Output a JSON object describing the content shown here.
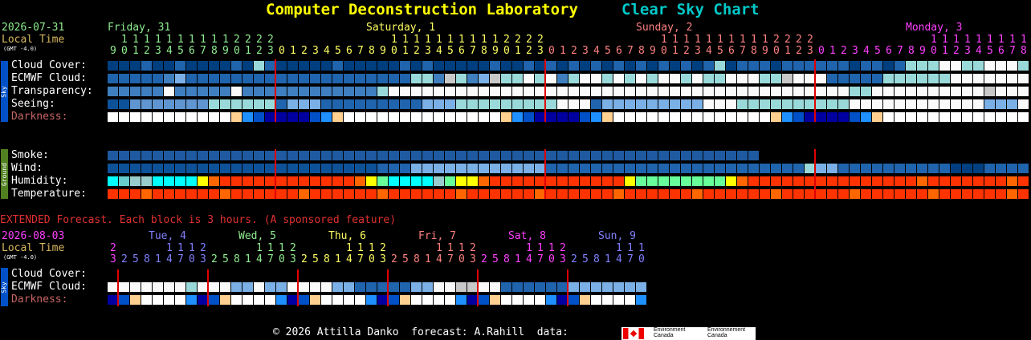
{
  "title": {
    "main": "Computer Deconstruction Laboratory",
    "chart": "Clear Sky Chart"
  },
  "header": {
    "date": "2026-07-31",
    "local_time": "Local Time",
    "gmt": "(GMT -4.0)"
  },
  "days": [
    {
      "label": "Friday, 31",
      "color": "#90ee90",
      "start": 9
    },
    {
      "label": "Saturday, 1",
      "color": "#ffff60",
      "start": 24
    },
    {
      "label": "Sunday, 2",
      "color": "#ff8080",
      "start": 48
    },
    {
      "label": "Monday, 3",
      "color": "#ff40ff",
      "start": 72
    }
  ],
  "sky_rows": [
    "Cloud Cover:",
    "ECMWF Cloud:",
    "Transparency:",
    "Seeing:",
    "Darkness:"
  ],
  "ground_rows": [
    "Smoke:",
    "Wind:",
    "Humidity:",
    "Temperature:"
  ],
  "side_labels": {
    "sky": "Sky",
    "ground": "Ground"
  },
  "extended": {
    "banner": "EXTENDED Forecast. Each block is 3 hours. (A sponsored feature)",
    "date": "2026-08-03",
    "local_time": "Local Time",
    "gmt": "(GMT -4.0)",
    "days": [
      {
        "label": "Tue, 4",
        "color": "#8080ff"
      },
      {
        "label": "Wed, 5",
        "color": "#90ee90"
      },
      {
        "label": "Thu, 6",
        "color": "#ffff60"
      },
      {
        "label": "Fri, 7",
        "color": "#ff8080"
      },
      {
        "label": "Sat, 8",
        "color": "#ff40ff"
      },
      {
        "label": "Sun, 9",
        "color": "#8080ff"
      }
    ],
    "hours": [
      3,
      2,
      5,
      8,
      1,
      4,
      7,
      0,
      3,
      2,
      5,
      8,
      1,
      4,
      7,
      0,
      3,
      2,
      5,
      8,
      1,
      4,
      7,
      0,
      3,
      2,
      5,
      8,
      1,
      4,
      7,
      0,
      3,
      2,
      5,
      8,
      1,
      4,
      7,
      0,
      3,
      2,
      5,
      8,
      1,
      4,
      7,
      0
    ],
    "rows": [
      "Cloud Cover:",
      "ECMWF Cloud:",
      "Darkness:"
    ]
  },
  "footer": {
    "text": "© 2026 Attilla Danko  forecast: A.Rahill  data:",
    "logo1": "Environment Canada",
    "logo2": "Environnement Canada"
  },
  "colors": {
    "title": "#ffff00",
    "chart": "#00c8c8",
    "darkness_label": "#c86464",
    "banner": "#e03030",
    "local": "#d8b860",
    "date": "#90ee90",
    "ext_date": "#ff40ff"
  }
}
